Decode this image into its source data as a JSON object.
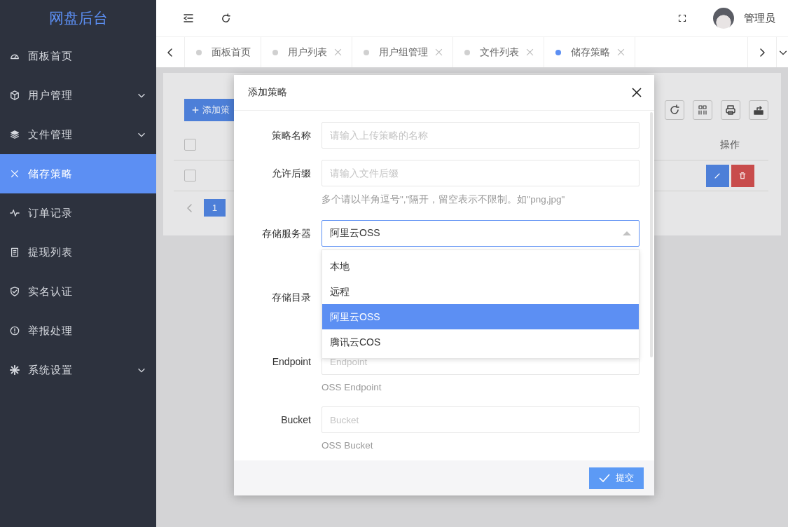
{
  "sidebar": {
    "logo": "网盘后台",
    "items": [
      {
        "label": "面板首页",
        "selected": false,
        "has_submenu": false
      },
      {
        "label": "用户管理",
        "selected": false,
        "has_submenu": true
      },
      {
        "label": "文件管理",
        "selected": false,
        "has_submenu": true
      },
      {
        "label": "储存策略",
        "selected": true,
        "has_submenu": false
      },
      {
        "label": "订单记录",
        "selected": false,
        "has_submenu": false
      },
      {
        "label": "提现列表",
        "selected": false,
        "has_submenu": false
      },
      {
        "label": "实名认证",
        "selected": false,
        "has_submenu": false
      },
      {
        "label": "举报处理",
        "selected": false,
        "has_submenu": false
      },
      {
        "label": "系统设置",
        "selected": false,
        "has_submenu": true
      }
    ]
  },
  "header": {
    "user": "管理员"
  },
  "tabs": [
    {
      "label": "面板首页",
      "selected": false,
      "closable": false
    },
    {
      "label": "用户列表",
      "selected": false,
      "closable": true
    },
    {
      "label": "用户组管理",
      "selected": false,
      "closable": true
    },
    {
      "label": "文件列表",
      "selected": false,
      "closable": true
    },
    {
      "label": "储存策略",
      "selected": true,
      "closable": true
    }
  ],
  "page": {
    "add_button": "添加策",
    "table": {
      "columns": [
        {
          "label": "操作"
        }
      ],
      "rows": [
        {
          "checked": false
        }
      ],
      "header_checked": false
    },
    "pagination": [
      {
        "label": "1",
        "selected": true
      }
    ]
  },
  "dialog": {
    "title": "添加策略",
    "submit": "提交",
    "fields": [
      {
        "kind": "input",
        "label": "策略名称",
        "placeholder": "请输入上传策略的名称"
      },
      {
        "kind": "input",
        "label": "允许后缀",
        "placeholder": "请输入文件后缀",
        "help": "多个请以半角逗号\",\"隔开，留空表示不限制。如\"png,jpg\""
      },
      {
        "kind": "select",
        "label": "存储服务器",
        "value": "阿里云OSS",
        "expanded": true,
        "options": [
          {
            "label": "本地",
            "selected": false
          },
          {
            "label": "远程",
            "selected": false
          },
          {
            "label": "阿里云OSS",
            "selected": true
          },
          {
            "label": "腾讯云COS",
            "selected": false
          }
        ]
      },
      {
        "kind": "hidden",
        "label": "存储目录"
      },
      {
        "kind": "input",
        "label": "Endpoint",
        "placeholder": "Endpoint",
        "help": "OSS Endpoint"
      },
      {
        "kind": "input",
        "label": "Bucket",
        "placeholder": "Bucket",
        "help": "OSS Bucket"
      }
    ]
  }
}
